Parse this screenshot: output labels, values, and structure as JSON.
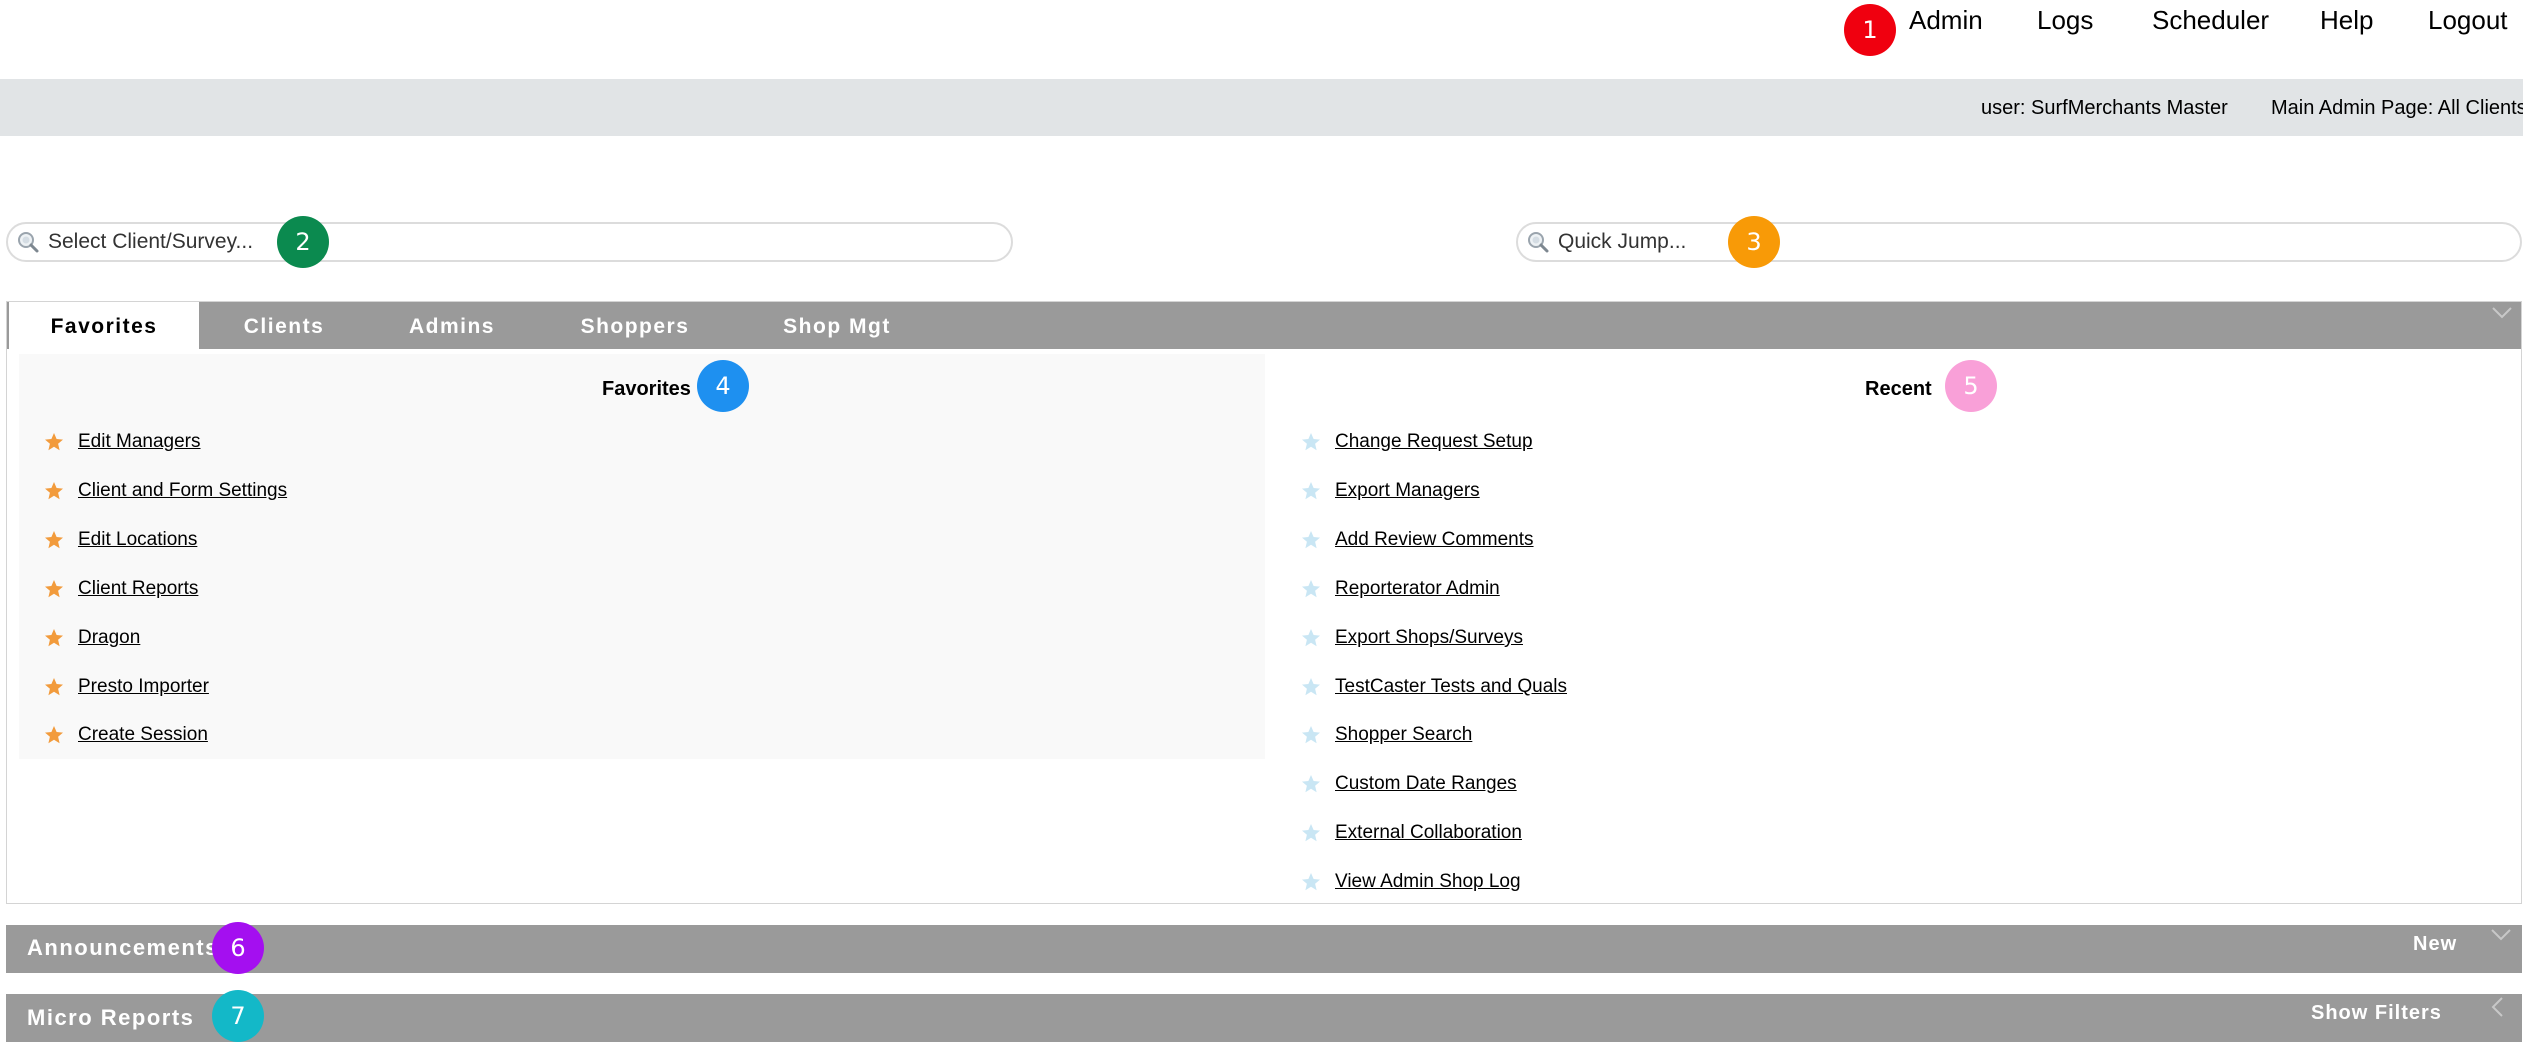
{
  "nav": {
    "items": [
      "Admin",
      "Logs",
      "Scheduler",
      "Help",
      "Logout"
    ]
  },
  "userbar": {
    "user": "user: SurfMerchants Master",
    "page": "Main Admin Page: All Clients"
  },
  "search": {
    "client_placeholder": "Select Client/Survey...",
    "jump_placeholder": "Quick Jump..."
  },
  "tabs": [
    "Favorites",
    "Clients",
    "Admins",
    "Shoppers",
    "Shop Mgt"
  ],
  "favorites": {
    "title": "Favorites",
    "items": [
      "Edit Managers",
      "Client and Form Settings",
      "Edit Locations",
      "Client Reports",
      "Dragon",
      "Presto Importer",
      "Create Session"
    ]
  },
  "recent": {
    "title": "Recent",
    "items": [
      "Change Request Setup",
      "Export Managers",
      "Add Review Comments",
      "Reporterator Admin",
      "Export Shops/Surveys",
      "TestCaster Tests and Quals",
      "Shopper Search",
      "Custom Date Ranges",
      "External Collaboration",
      "View Admin Shop Log"
    ]
  },
  "announcements": {
    "title": "Announcements",
    "new_label": "New"
  },
  "micro_reports": {
    "title": "Micro Reports",
    "filters_label": "Show Filters"
  },
  "badges": [
    "1",
    "2",
    "3",
    "4",
    "5",
    "6",
    "7"
  ],
  "colors": {
    "badge_1": "#f0000f",
    "badge_2": "#0b8a4f",
    "badge_3": "#f89a07",
    "badge_4": "#1e90f0",
    "badge_5": "#f9a0d8",
    "badge_6": "#a40ff0",
    "badge_7": "#13b8c8",
    "bar_gray": "#9a9a9a",
    "userbar_gray": "#e1e4e6",
    "fav_star": "#f29b3c",
    "recent_star": "#c9e6f4"
  },
  "icons": {
    "search": "magnifier-icon",
    "favorite": "star-filled-icon",
    "recent": "star-light-icon",
    "collapse": "chevron-down-icon",
    "expand": "chevron-left-icon"
  }
}
